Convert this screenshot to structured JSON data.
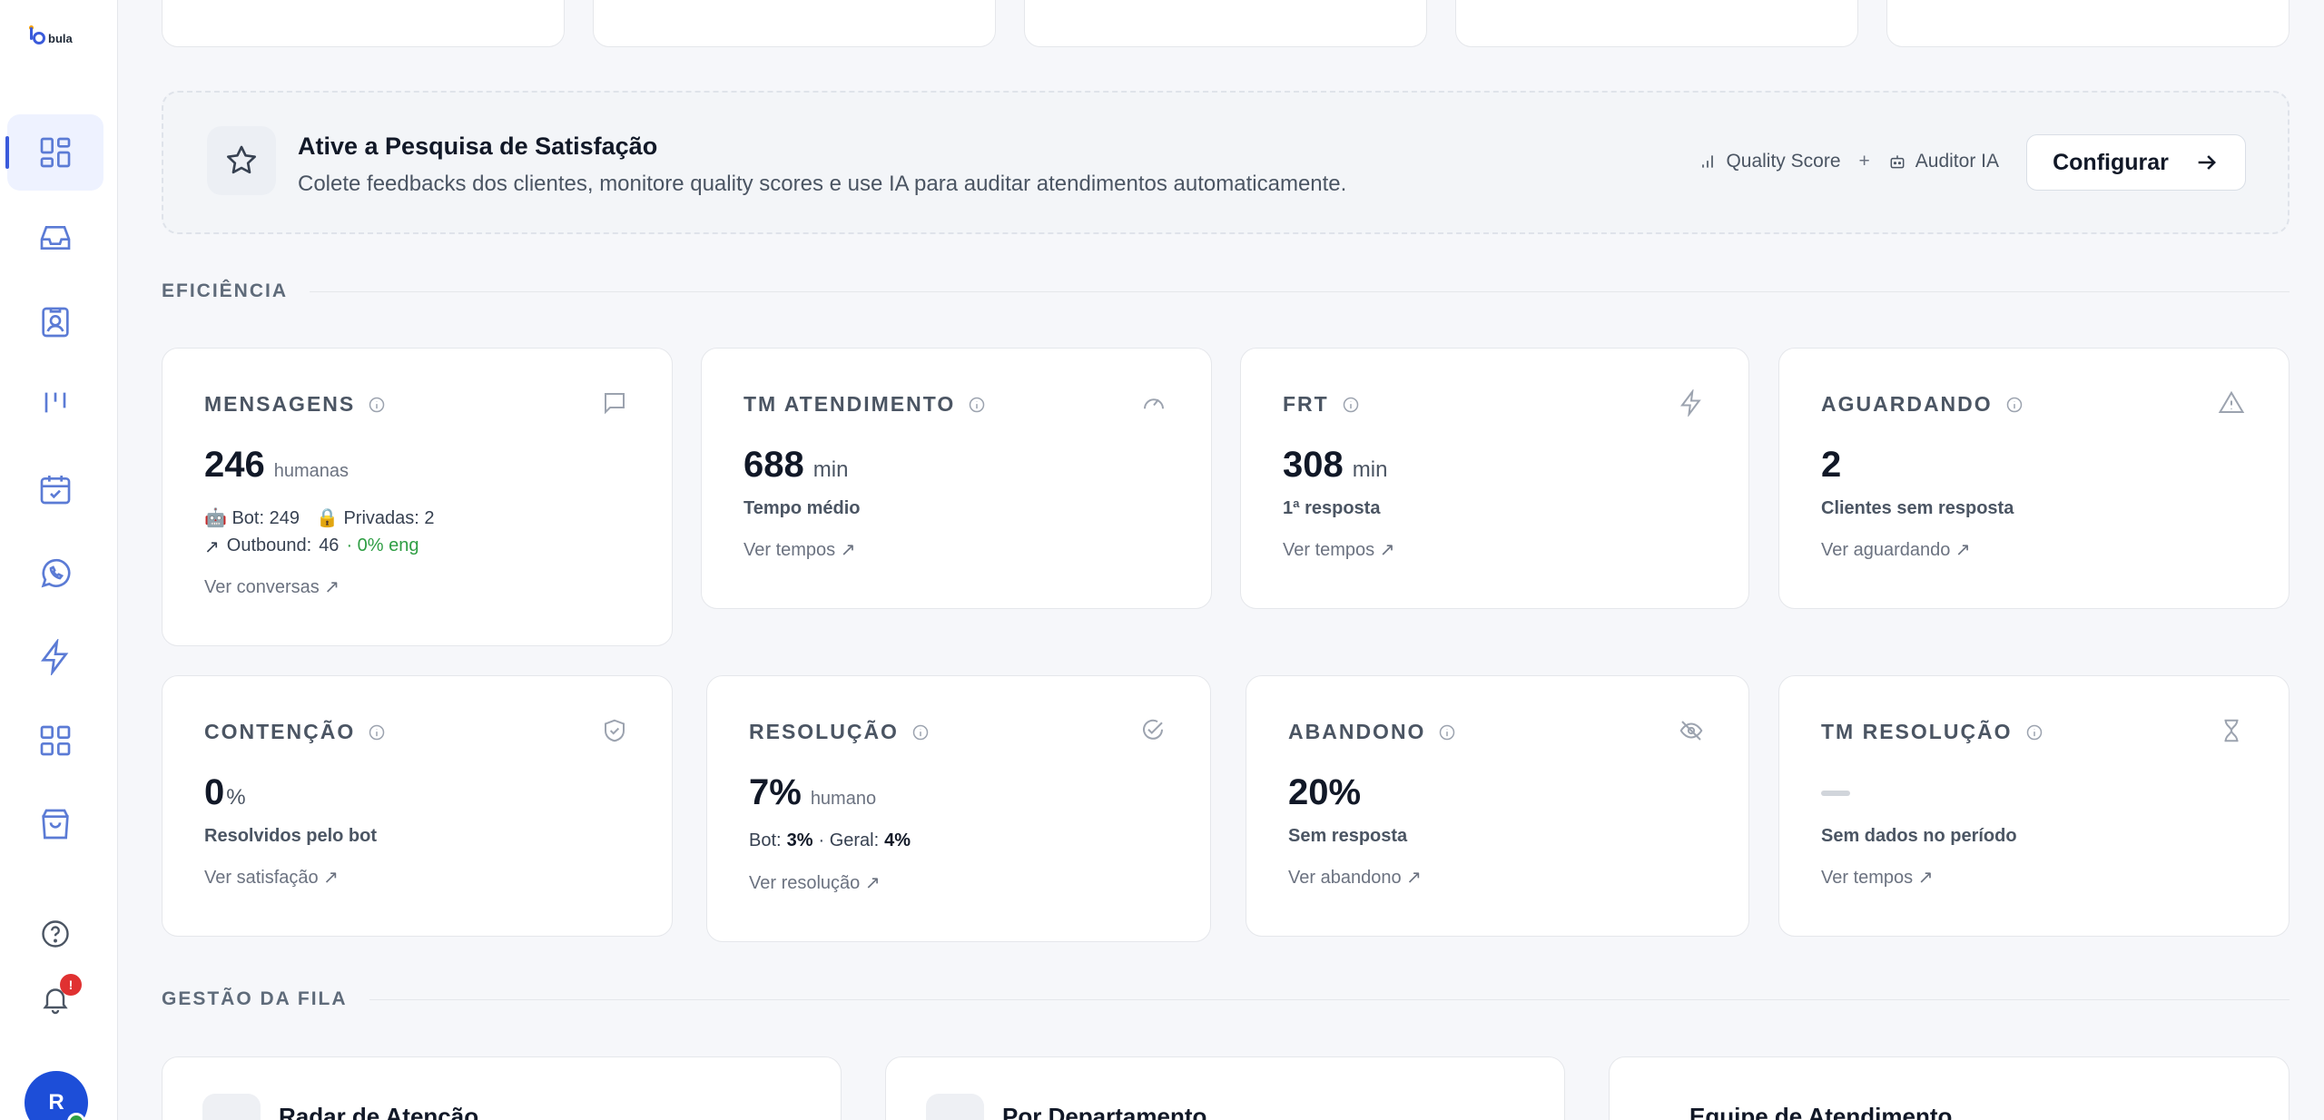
{
  "app": {
    "logo_text": "bula"
  },
  "sidebar": {
    "items": [
      {
        "icon": "dashboard-icon",
        "active": true
      },
      {
        "icon": "inbox-icon",
        "active": false
      },
      {
        "icon": "contacts-icon",
        "active": false
      },
      {
        "icon": "kanban-icon",
        "active": false
      },
      {
        "icon": "calendar-icon",
        "active": false
      },
      {
        "icon": "whatsapp-icon",
        "active": false
      },
      {
        "icon": "automation-icon",
        "active": false
      },
      {
        "icon": "apps-icon",
        "active": false
      },
      {
        "icon": "store-icon",
        "active": false
      }
    ],
    "help_icon": "help-icon",
    "bell_icon": "bell-icon",
    "notification_badge": "!",
    "avatar_initial": "R"
  },
  "banner": {
    "title": "Ative a Pesquisa de Satisfação",
    "description": "Colete feedbacks dos clientes, monitore quality scores e use IA para auditar atendimentos automaticamente.",
    "tag_quality": "Quality Score",
    "plus": "+",
    "tag_auditor": "Auditor IA",
    "button_label": "Configurar"
  },
  "sections": {
    "eficiencia": "EFICIÊNCIA",
    "gestao": "GESTÃO DA FILA"
  },
  "metrics": {
    "mensagens": {
      "label": "MENSAGENS",
      "value": "246",
      "sub": "humanas",
      "bot_label": "Bot:",
      "bot_value": "249",
      "privadas_label": "Privadas:",
      "privadas_value": "2",
      "outbound_label": "Outbound:",
      "outbound_value": "46",
      "eng": "· 0% eng",
      "link": "Ver conversas ↗"
    },
    "tm_atendimento": {
      "label": "TM ATENDIMENTO",
      "value": "688",
      "unit": "min",
      "desc": "Tempo médio",
      "link": "Ver tempos ↗"
    },
    "frt": {
      "label": "FRT",
      "value": "308",
      "unit": "min",
      "desc": "1ª resposta",
      "link": "Ver tempos ↗"
    },
    "aguardando": {
      "label": "AGUARDANDO",
      "value": "2",
      "desc": "Clientes sem resposta",
      "link": "Ver aguardando ↗"
    },
    "contencao": {
      "label": "CONTENÇÃO",
      "value": "0",
      "unit": "%",
      "desc": "Resolvidos pelo bot",
      "link": "Ver satisfação ↗"
    },
    "resolucao": {
      "label": "RESOLUÇÃO",
      "value": "7%",
      "sub": "humano",
      "bot_label": "Bot:",
      "bot_value": "3%",
      "geral_label": "· Geral:",
      "geral_value": "4%",
      "link": "Ver resolução ↗"
    },
    "abandono": {
      "label": "ABANDONO",
      "value": "20%",
      "desc": "Sem resposta",
      "link": "Ver abandono ↗"
    },
    "tm_resolucao": {
      "label": "TM RESOLUÇÃO",
      "desc": "Sem dados no período",
      "link": "Ver tempos ↗"
    }
  },
  "bottom_cards": {
    "radar": "Radar de Atenção",
    "departamento": "Por Departamento",
    "equipe": "Equipe de Atendimento"
  }
}
